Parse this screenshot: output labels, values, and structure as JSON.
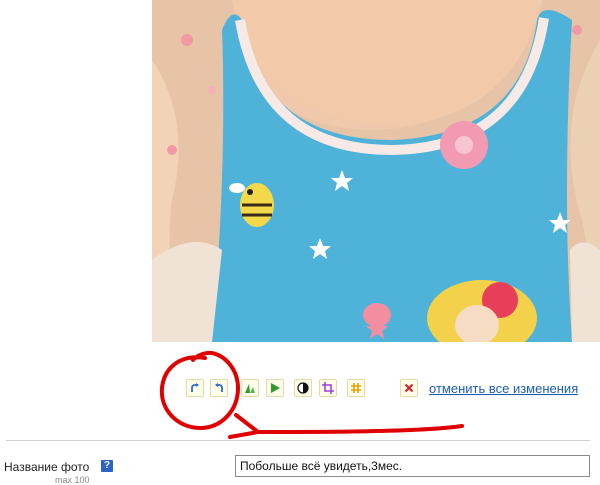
{
  "photo": {
    "subject": "baby in a blue bib with bee and flower print"
  },
  "toolbar": {
    "tools": [
      {
        "name": "rotate-right-icon",
        "color": "#2a6fcf"
      },
      {
        "name": "rotate-left-icon",
        "color": "#2a6fcf"
      },
      {
        "name": "levels-icon",
        "color": "#2e9a2e"
      },
      {
        "name": "play-forward-icon",
        "color": "#2e9a2e"
      },
      {
        "name": "contrast-icon",
        "color": "#111111"
      },
      {
        "name": "crop-icon",
        "color": "#9b3fd6"
      },
      {
        "name": "grid-icon",
        "color": "#e3a100"
      },
      {
        "name": "delete-icon",
        "color": "#d71f1f"
      }
    ],
    "revert_label": "отменить все изменения"
  },
  "annotation": {
    "color": "#e00000"
  },
  "form": {
    "title_label": "Название фото",
    "help_glyph": "?",
    "hint": "max 100",
    "title_value": "Побольше всё увидеть,3мес."
  }
}
